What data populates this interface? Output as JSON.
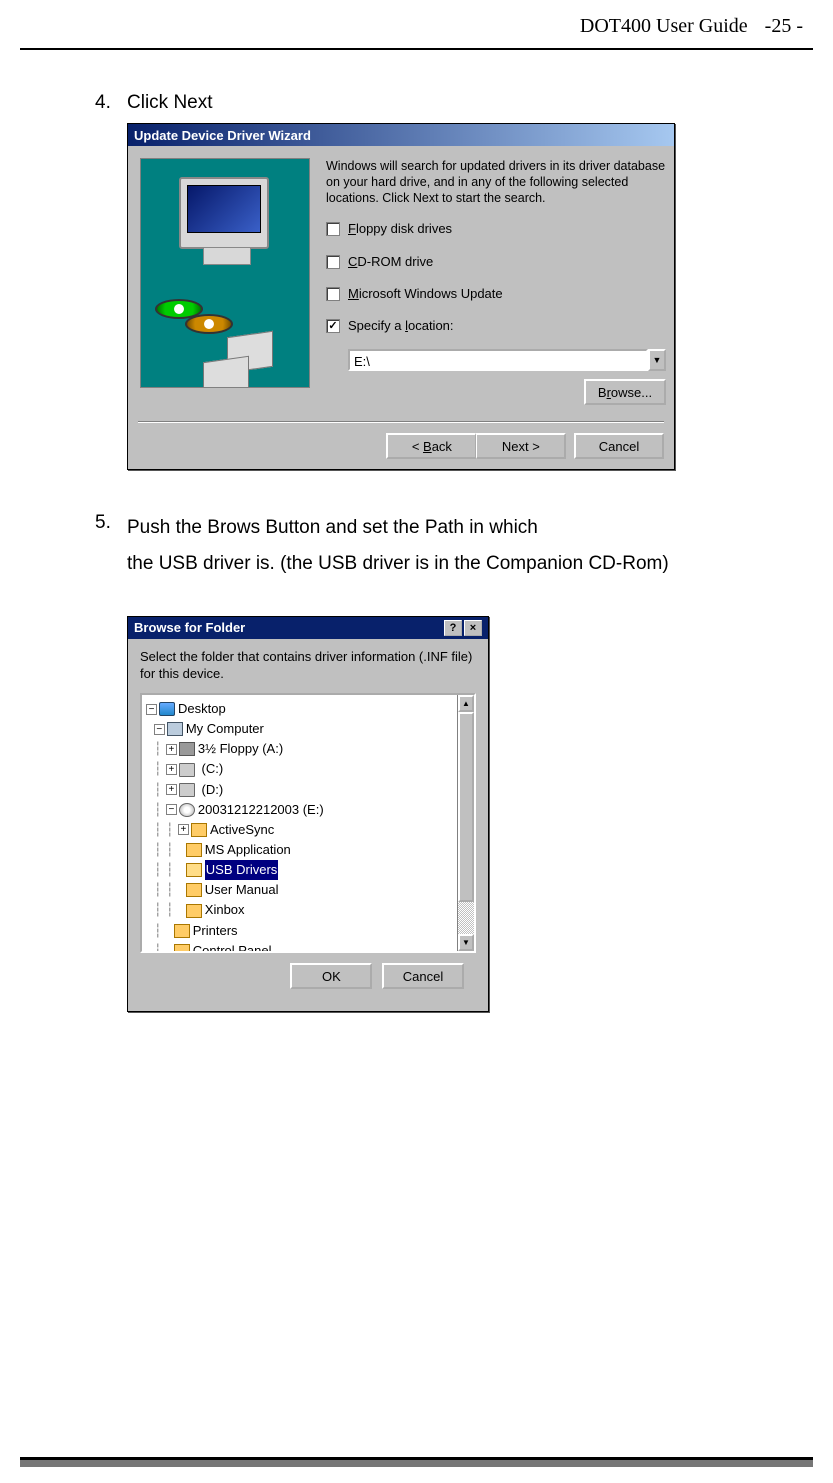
{
  "header": {
    "guide": "DOT400 User Guide",
    "page": "-25 -"
  },
  "steps": {
    "s4": {
      "num": "4.",
      "text": "Click Next"
    },
    "s5": {
      "num": "5.",
      "line1": "Push the Brows Button and set the Path in which",
      "line2": "the USB driver is. (the USB driver is in the Companion CD-Rom)"
    }
  },
  "wizard": {
    "title": "Update Device Driver Wizard",
    "intro": "Windows will search for updated drivers in its driver database on your hard drive, and in any of the following selected locations. Click Next to start the search.",
    "opt_floppy": "Floppy disk drives",
    "opt_cdrom": "CD-ROM drive",
    "opt_winupd": "Microsoft Windows Update",
    "opt_specify": "Specify a location:",
    "path_value": "E:\\",
    "btn_browse": "Browse...",
    "btn_back": "< Back",
    "btn_next": "Next >",
    "btn_cancel": "Cancel"
  },
  "browse": {
    "title": "Browse for Folder",
    "instr": "Select the folder that contains driver information (.INF file) for this device.",
    "tree": {
      "desktop": "Desktop",
      "mycomputer": "My Computer",
      "floppy": "3½ Floppy (A:)",
      "c": " (C:)",
      "d": " (D:)",
      "e": "20031212212003 (E:)",
      "activesync": "ActiveSync",
      "msapp": "MS Application",
      "usb": "USB Drivers",
      "usermanual": "User Manual",
      "xinbox": "Xinbox",
      "printers": "Printers",
      "controlpanel": "Control Panel"
    },
    "btn_ok": "OK",
    "btn_cancel": "Cancel",
    "help": "?",
    "close": "×"
  }
}
